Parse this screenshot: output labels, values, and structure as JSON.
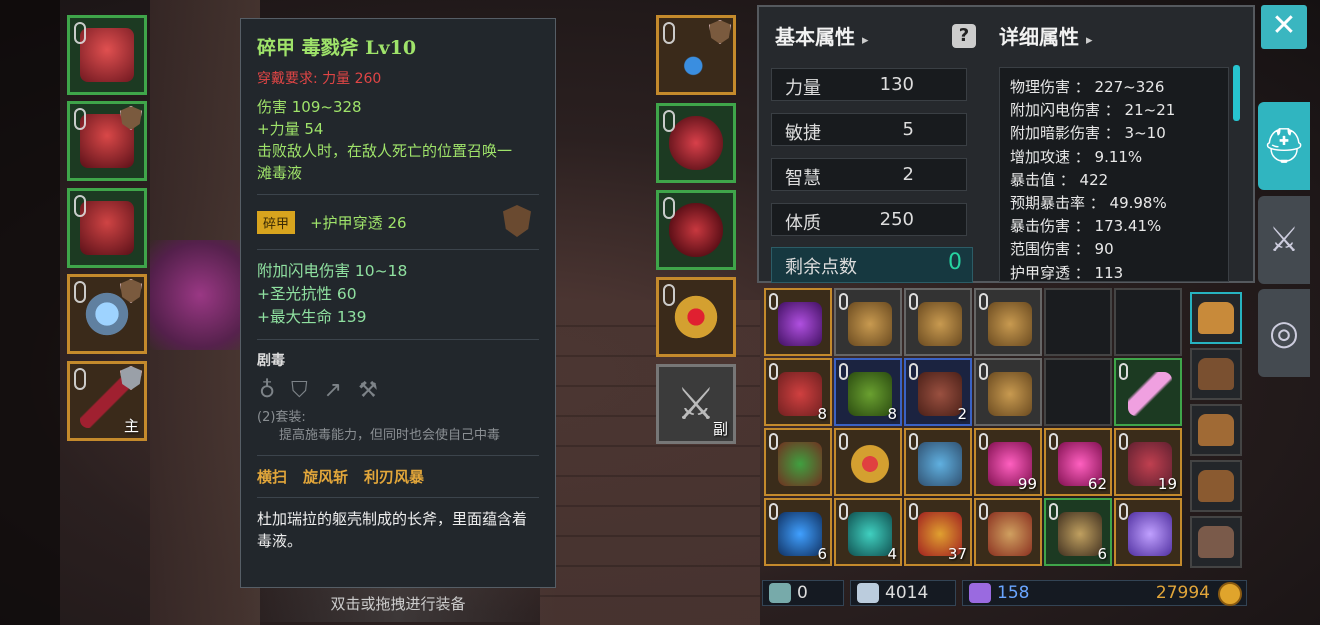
{
  "tooltip": {
    "title": "碎甲 毒戮斧 Lv10",
    "requirement": "穿戴要求:  力量 260",
    "base_lines": [
      "伤害  109~328",
      "+力量 54",
      "击败敌人时，在敌人死亡的位置召唤一",
      "滩毒液"
    ],
    "affix_tag": "碎甲",
    "affix_text": "+护甲穿透 26",
    "extra_lines": [
      "附加闪电伤害 10~18",
      "+圣光抗性 60",
      "+最大生命 139"
    ],
    "set_name": "剧毒",
    "set_icons": [
      "necklace-icon",
      "armor-icon",
      "spear-icon",
      "axe-icon"
    ],
    "set_bonus_label": "(2)套装:",
    "set_bonus_text": "提高施毒能力，但同时也会使自己中毒",
    "skills": [
      "横扫",
      "旋风斩",
      "利刃风暴"
    ],
    "description": "杜加瑞拉的躯壳制成的长斧，里面蕴含着毒液。"
  },
  "equip_hint": "双击或拖拽进行装备",
  "left_slots": [
    {
      "name": "helmet-slot",
      "tag": ""
    },
    {
      "name": "chest-armor-slot",
      "tag": ""
    },
    {
      "name": "leg-armor-slot",
      "tag": ""
    },
    {
      "name": "ring-slot",
      "tag": ""
    },
    {
      "name": "main-weapon-slot",
      "tag": "主"
    }
  ],
  "right_slots": [
    {
      "name": "necklace-slot",
      "tag": ""
    },
    {
      "name": "gloves-slot",
      "tag": ""
    },
    {
      "name": "boots-slot",
      "tag": ""
    },
    {
      "name": "ring2-slot",
      "tag": ""
    },
    {
      "name": "offhand-weapon-slot",
      "tag": "副"
    }
  ],
  "panel": {
    "basic_title": "基本属性",
    "detail_title": "详细属性",
    "stats": [
      {
        "label": "力量",
        "value": "130"
      },
      {
        "label": "敏捷",
        "value": "5"
      },
      {
        "label": "智慧",
        "value": "2"
      },
      {
        "label": "体质",
        "value": "250"
      }
    ],
    "remaining_label": "剩余点数",
    "remaining_value": "0",
    "details": [
      "物理伤害 ： 227~326",
      "附加闪电伤害 ： 21~21",
      "附加暗影伤害 ： 3~10",
      "增加攻速 ： 9.11%",
      "暴击值 ： 422",
      "预期暴击率 ： 49.98%",
      "暴击伤害 ： 173.41%",
      "范围伤害 ： 90",
      "护甲穿透 ： 113"
    ]
  },
  "inventory": {
    "cells": [
      {
        "name": "purple-potion",
        "count": "",
        "rarity": "gold"
      },
      {
        "name": "backpack",
        "count": "",
        "rarity": "gray"
      },
      {
        "name": "backpack",
        "count": "",
        "rarity": "gray"
      },
      {
        "name": "backpack",
        "count": "",
        "rarity": "gray"
      },
      {
        "name": "empty",
        "count": "",
        "rarity": "empty"
      },
      {
        "name": "empty",
        "count": "",
        "rarity": "empty"
      },
      {
        "name": "spiked-helmet",
        "count": "8",
        "rarity": "gold"
      },
      {
        "name": "green-material",
        "count": "8",
        "rarity": "blue"
      },
      {
        "name": "brown-material",
        "count": "2",
        "rarity": "blue"
      },
      {
        "name": "backpack",
        "count": "",
        "rarity": "gray"
      },
      {
        "name": "empty",
        "count": "",
        "rarity": "empty"
      },
      {
        "name": "pink-scythe",
        "count": "",
        "rarity": "green"
      },
      {
        "name": "green-potion",
        "count": "",
        "rarity": "gold"
      },
      {
        "name": "gold-ring",
        "count": "",
        "rarity": "gold"
      },
      {
        "name": "map-scroll",
        "count": "",
        "rarity": "gold"
      },
      {
        "name": "pink-gem",
        "count": "99",
        "rarity": "gold"
      },
      {
        "name": "pink-gem",
        "count": "62",
        "rarity": "gold"
      },
      {
        "name": "red-gauntlet",
        "count": "19",
        "rarity": "gold"
      },
      {
        "name": "blue-orb",
        "count": "6",
        "rarity": "gold"
      },
      {
        "name": "teal-orb",
        "count": "4",
        "rarity": "gold"
      },
      {
        "name": "red-swirl",
        "count": "37",
        "rarity": "gold"
      },
      {
        "name": "scroll",
        "count": "",
        "rarity": "gold"
      },
      {
        "name": "dark-helmet",
        "count": "6",
        "rarity": "green"
      },
      {
        "name": "purple-crystal",
        "count": "",
        "rarity": "gold"
      }
    ]
  },
  "currency": {
    "keys": "0",
    "diamonds": "4014",
    "crystals": "158",
    "gold": "27994"
  },
  "colors": {
    "accent": "#30b5c0",
    "title_green": "#9fe36a",
    "requirement_red": "#e04545",
    "skill_gold": "#e2a63a"
  }
}
